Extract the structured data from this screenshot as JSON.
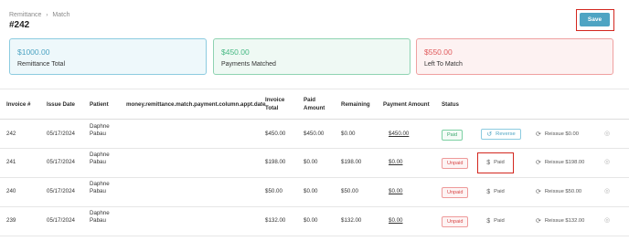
{
  "breadcrumb": {
    "parent": "Remittance",
    "separator": "›",
    "current": "Match"
  },
  "page_title": "#242",
  "save_label": "Save",
  "summary": {
    "total_amount": "$1000.00",
    "total_label": "Remittance Total",
    "matched_amount": "$450.00",
    "matched_label": "Payments Matched",
    "left_amount": "$550.00",
    "left_label": "Left To Match"
  },
  "table": {
    "headers": {
      "invoice": "Invoice #",
      "issue_date": "Issue Date",
      "patient": "Patient",
      "appt_date": "money.remittance.match.payment.column.appt.date",
      "invoice_total": "Invoice Total",
      "paid_amount": "Paid Amount",
      "remaining": "Remaining",
      "payment_amount": "Payment Amount",
      "status": "Status"
    },
    "rows": [
      {
        "invoice": "242",
        "issue_date": "05/17/2024",
        "patient": "Daphne Pabau",
        "invoice_total": "$450.00",
        "paid_amount": "$450.00",
        "remaining": "$0.00",
        "payment_amount": "$450.00",
        "status": "Paid",
        "action": "Reverse",
        "reissue": "Reissue $0.00"
      },
      {
        "invoice": "241",
        "issue_date": "05/17/2024",
        "patient": "Daphne Pabau",
        "invoice_total": "$198.00",
        "paid_amount": "$0.00",
        "remaining": "$198.00",
        "payment_amount": "$0.00",
        "status": "Unpaid",
        "action": "Paid",
        "reissue": "Reissue $198.00"
      },
      {
        "invoice": "240",
        "issue_date": "05/17/2024",
        "patient": "Daphne Pabau",
        "invoice_total": "$50.00",
        "paid_amount": "$0.00",
        "remaining": "$50.00",
        "payment_amount": "$0.00",
        "status": "Unpaid",
        "action": "Paid",
        "reissue": "Reissue $50.00"
      },
      {
        "invoice": "239",
        "issue_date": "05/17/2024",
        "patient": "Daphne Pabau",
        "invoice_total": "$132.00",
        "paid_amount": "$0.00",
        "remaining": "$132.00",
        "payment_amount": "$0.00",
        "status": "Unpaid",
        "action": "Paid",
        "reissue": "Reissue $132.00"
      }
    ]
  },
  "icons": {
    "reverse": "undo-icon",
    "paid": "dollar-circle-icon",
    "reissue": "refresh-icon",
    "info": "info-icon"
  },
  "colors": {
    "accent": "#4ea4c3",
    "success": "#46b883",
    "danger": "#e0595b",
    "highlight": "#d3271f"
  }
}
